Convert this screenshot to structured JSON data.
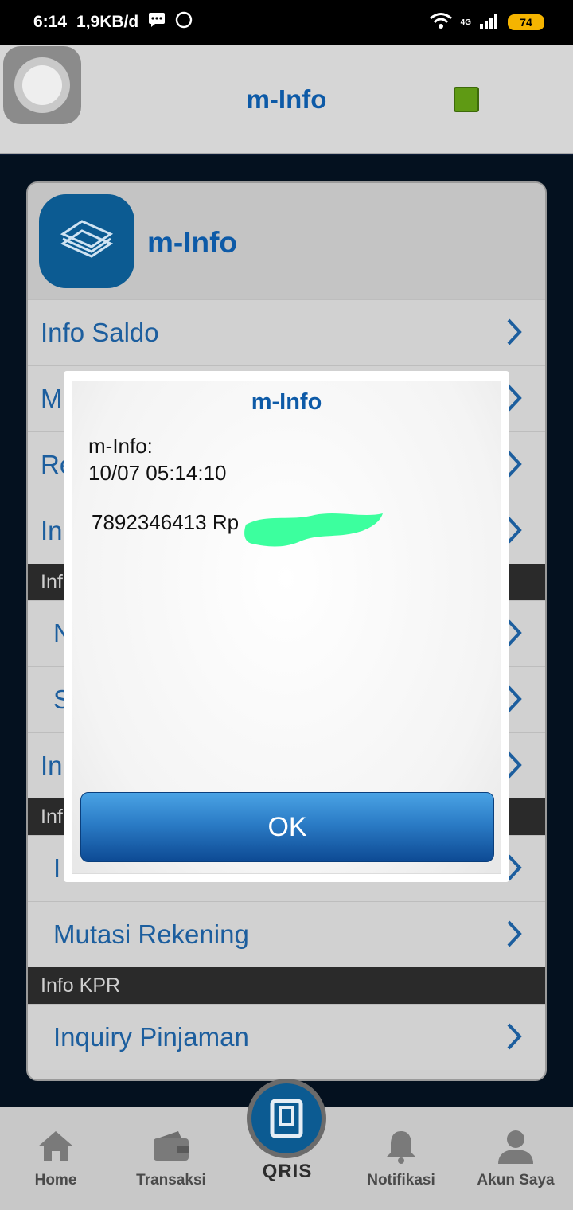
{
  "status_bar": {
    "time": "6:14",
    "data_rate": "1,9KB/d",
    "network": "4G",
    "battery": "74"
  },
  "header": {
    "title": "m-Info",
    "status_color": "#5f9a14"
  },
  "card": {
    "title": "m-Info",
    "rows": [
      {
        "label": "Info Saldo"
      },
      {
        "label": "M"
      },
      {
        "label": "Re"
      },
      {
        "label": "In"
      }
    ],
    "section1": "Inf",
    "rows2": [
      {
        "label": "N"
      },
      {
        "label": "S"
      }
    ],
    "row3": "In",
    "section2": "Inf",
    "row4": "I",
    "row5": "Mutasi Rekening",
    "section3": "Info KPR",
    "row6": "Inquiry Pinjaman"
  },
  "dialog": {
    "title": "m-Info",
    "line1": "m-Info:",
    "line2": "10/07 05:14:10",
    "account_line": "7892346413 Rp",
    "ok_label": "OK"
  },
  "bottom_nav": {
    "items": [
      {
        "label": "Home",
        "icon": "home-icon"
      },
      {
        "label": "Transaksi",
        "icon": "wallet-icon"
      },
      {
        "label": "Notifikasi",
        "icon": "bell-icon"
      },
      {
        "label": "Akun Saya",
        "icon": "user-icon"
      }
    ],
    "qris_label": "QRIS"
  },
  "colors": {
    "accent": "#0d5aa7",
    "ok_button": "#2b7cc6",
    "redaction": "#3cff9e"
  }
}
